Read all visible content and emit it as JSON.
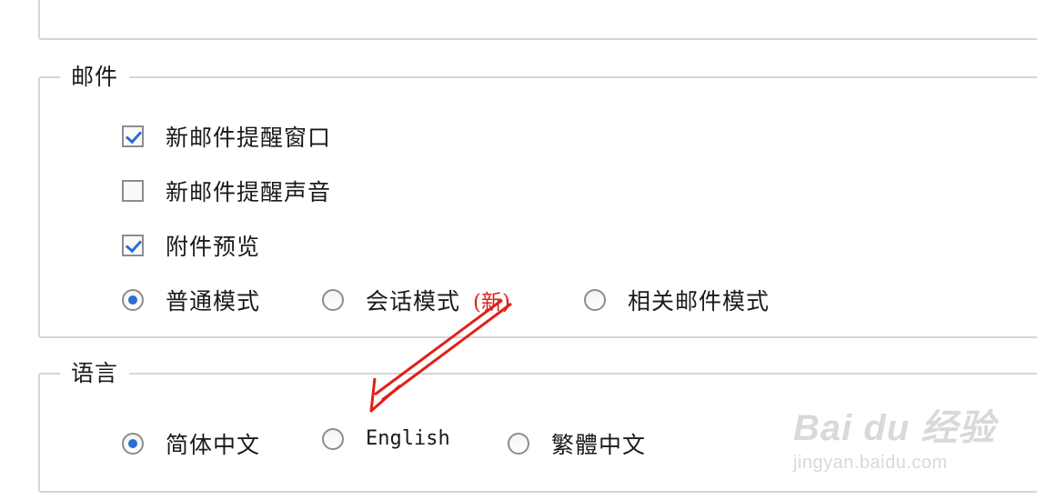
{
  "top_section": {
    "setting_label": "",
    "select_value": ""
  },
  "mail": {
    "legend": "邮件",
    "checkboxes": [
      {
        "label": "新邮件提醒窗口",
        "checked": true
      },
      {
        "label": "新邮件提醒声音",
        "checked": false
      },
      {
        "label": "附件预览",
        "checked": true
      }
    ],
    "view_modes": [
      {
        "label": "普通模式",
        "selected": true
      },
      {
        "label": "会话模式",
        "selected": false,
        "badge": "(新)"
      },
      {
        "label": "相关邮件模式",
        "selected": false
      }
    ]
  },
  "language": {
    "legend": "语言",
    "options": [
      {
        "label": "简体中文",
        "selected": true
      },
      {
        "label": "English",
        "selected": false
      },
      {
        "label": "繁體中文",
        "selected": false
      }
    ]
  },
  "annotation": {
    "type": "red-arrow",
    "color": "#e0201a",
    "points_to": "English"
  },
  "watermark": {
    "brand": "Bai du 经验",
    "url": "jingyan.baidu.com"
  }
}
